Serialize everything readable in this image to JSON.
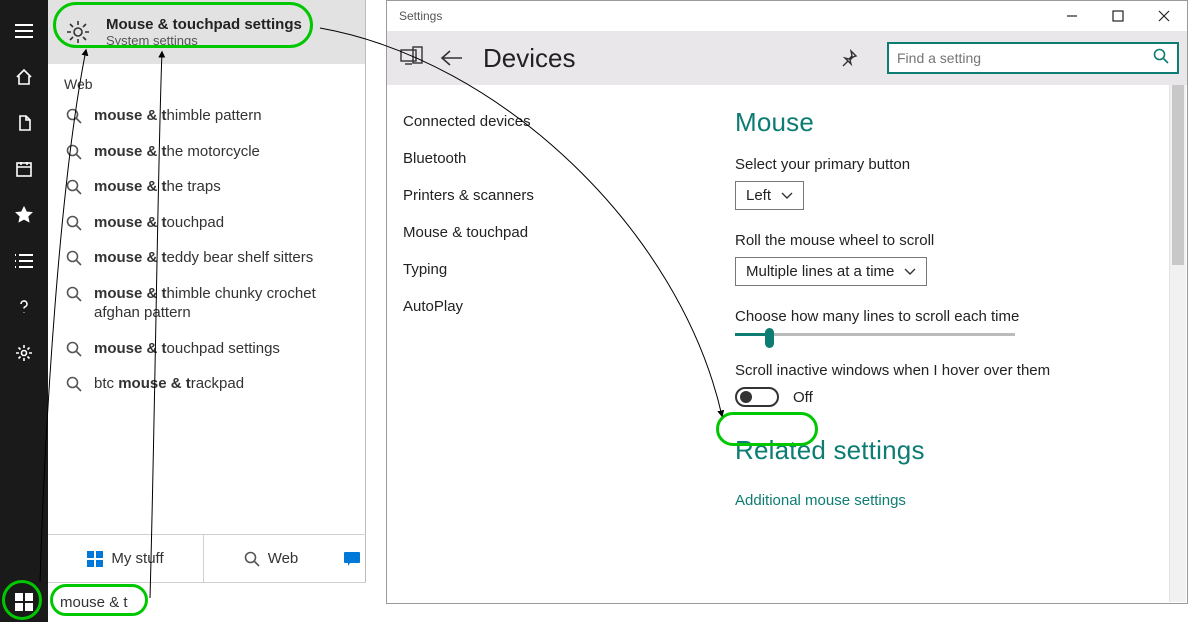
{
  "start_sidebar": {
    "items": [
      "menu",
      "home",
      "recent",
      "calendar",
      "favorites",
      "list",
      "help",
      "settings"
    ]
  },
  "best_match": {
    "title": "Mouse & touchpad settings",
    "subtitle": "System settings"
  },
  "web_header": "Web",
  "web_suggestions": [
    {
      "pre": "mouse & t",
      "post": "himble pattern"
    },
    {
      "pre": "mouse & t",
      "post": "he motorcycle"
    },
    {
      "pre": "mouse & t",
      "post": "he traps"
    },
    {
      "pre": "mouse & t",
      "post": "ouchpad"
    },
    {
      "pre": "mouse & t",
      "post": "eddy bear shelf sitters"
    },
    {
      "pre": "mouse & t",
      "post": "himble chunky crochet afghan pattern"
    },
    {
      "pre": "mouse & t",
      "post": "ouchpad settings"
    },
    {
      "plain_pre": "btc ",
      "pre": "mouse & t",
      "post": "rackpad"
    }
  ],
  "start_tabs": {
    "mystuff": "My stuff",
    "web": "Web"
  },
  "search_query": "mouse & t",
  "settings": {
    "window_title": "Settings",
    "page_title": "Devices",
    "search_placeholder": "Find a setting",
    "nav": [
      "Connected devices",
      "Bluetooth",
      "Printers & scanners",
      "Mouse & touchpad",
      "Typing",
      "AutoPlay"
    ],
    "content": {
      "heading": "Mouse",
      "primary_label": "Select your primary button",
      "primary_value": "Left",
      "wheel_label": "Roll the mouse wheel to scroll",
      "wheel_value": "Multiple lines at a time",
      "lines_label": "Choose how many lines to scroll each time",
      "lines_value_pct": 12,
      "inactive_label": "Scroll inactive windows when I hover over them",
      "inactive_value": "Off",
      "related_heading": "Related settings",
      "related_link": "Additional mouse settings"
    }
  }
}
